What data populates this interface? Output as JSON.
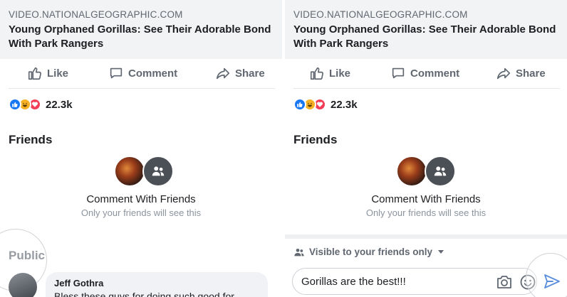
{
  "post": {
    "source": "VIDEO.NATIONALGEOGRAPHIC.COM",
    "headline_line1": "Young Orphaned Gorillas: See Their Adorable Bond",
    "headline_line2": "With Park Rangers"
  },
  "actions": {
    "like": "Like",
    "comment": "Comment",
    "share": "Share"
  },
  "reactions": {
    "count": "22.3k",
    "types": [
      "like",
      "haha",
      "love"
    ]
  },
  "friends": {
    "title": "Friends",
    "cta_title": "Comment With Friends",
    "cta_subtitle": "Only your friends will see this"
  },
  "public_section": {
    "title": "Public",
    "comment": {
      "author": "Jeff Gothra",
      "text": "Bless these guys for doing such good for"
    }
  },
  "composer": {
    "visibility": "Visible to your friends only",
    "input_value": "Gorillas are the best!!!"
  },
  "colors": {
    "brand_blue": "#1877f2",
    "haha_yellow": "#f7b125",
    "love_red": "#f33e58",
    "send_blue": "#5b8fdc"
  }
}
